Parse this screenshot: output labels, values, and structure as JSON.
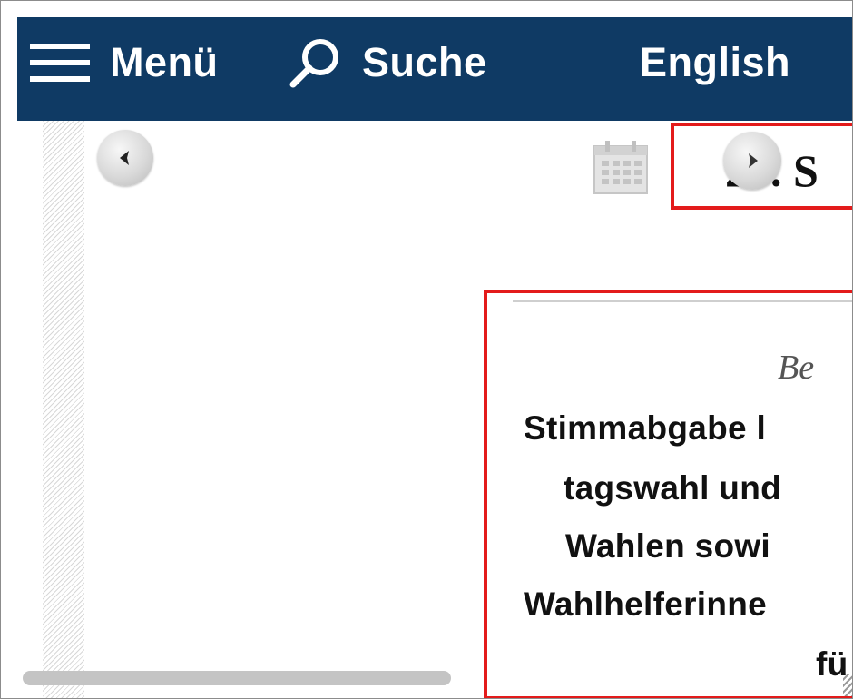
{
  "topbar": {
    "menu_label": "Menü",
    "search_label": "Suche",
    "language_label": "English",
    "background_color": "#0f3a64"
  },
  "icons": {
    "menu": "hamburger-icon",
    "search": "search-icon",
    "prev": "chevron-left-icon",
    "next": "chevron-right-icon",
    "calendar": "calendar-icon"
  },
  "date_header": {
    "text": "26. S"
  },
  "article": {
    "kicker": "Be",
    "headline_lines": [
      "Stimmabgabe l",
      "tagswahl und",
      "Wahlen sowi",
      "Wahlhelferinne",
      "fü"
    ]
  },
  "highlight_color": "#e31b1b"
}
